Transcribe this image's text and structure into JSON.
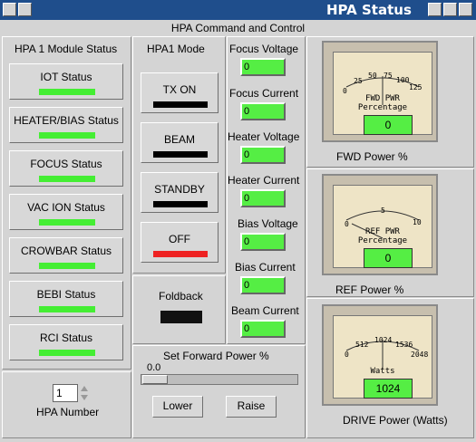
{
  "window": {
    "title": "HPA Status"
  },
  "header": {
    "title": "HPA Command and Control"
  },
  "module_status": {
    "title": "HPA 1 Module Status",
    "items": [
      {
        "label": "IOT Status"
      },
      {
        "label": "HEATER/BIAS Status"
      },
      {
        "label": "FOCUS Status"
      },
      {
        "label": "VAC ION Status"
      },
      {
        "label": "CROWBAR Status"
      },
      {
        "label": "BEBI Status"
      },
      {
        "label": "RCI Status"
      }
    ],
    "indicator_color": "#44ee33"
  },
  "hpa_number": {
    "label": "HPA Number",
    "value": "1"
  },
  "mode": {
    "title": "HPA1 Mode",
    "buttons": [
      {
        "label": "TX ON",
        "indicator": "#000000"
      },
      {
        "label": "BEAM",
        "indicator": "#000000"
      },
      {
        "label": "STANDBY",
        "indicator": "#000000"
      },
      {
        "label": "OFF",
        "indicator": "#ee2222"
      }
    ],
    "foldback_label": "Foldback"
  },
  "readings": [
    {
      "label": "Focus Voltage",
      "value": "0"
    },
    {
      "label": "Focus Current",
      "value": "0"
    },
    {
      "label": "Heater Voltage",
      "value": "0"
    },
    {
      "label": "Heater Current",
      "value": "0"
    },
    {
      "label": "Bias Voltage",
      "value": "0"
    },
    {
      "label": "Bias Current",
      "value": "0"
    },
    {
      "label": "Beam Current",
      "value": "0"
    }
  ],
  "power": {
    "label": "Set Forward Power %",
    "value": "0.0",
    "lower_label": "Lower",
    "raise_label": "Raise"
  },
  "gauges": [
    {
      "title": "FWD PWR",
      "subtitle": "Percentage",
      "value": "0",
      "ticks": [
        "0",
        "25",
        "50",
        "75",
        "100",
        "125"
      ],
      "caption": "FWD Power %"
    },
    {
      "title": "REF PWR",
      "subtitle": "Percentage",
      "value": "0",
      "ticks": [
        "0",
        "5",
        "10"
      ],
      "caption": "REF Power %"
    },
    {
      "title": "",
      "subtitle": "Watts",
      "value": "1024",
      "ticks": [
        "0",
        "512",
        "1024",
        "1536",
        "2048"
      ],
      "caption": "DRIVE Power (Watts)"
    }
  ]
}
